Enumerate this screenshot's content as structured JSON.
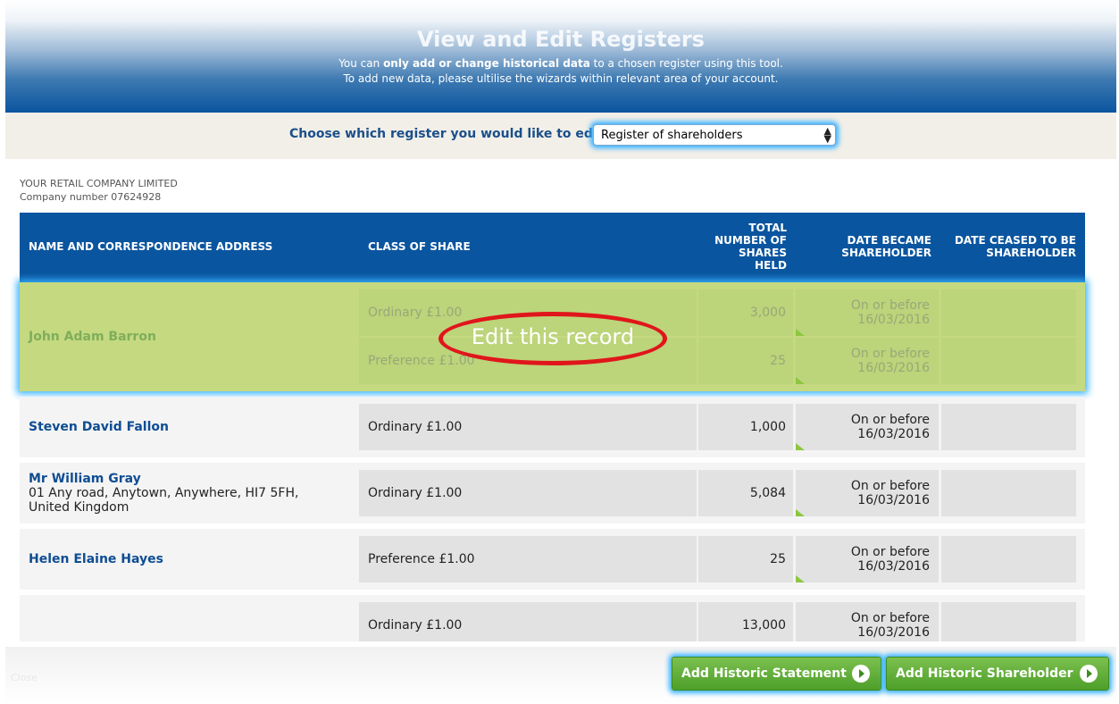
{
  "header": {
    "title": "View and Edit Registers",
    "line1_prefix": "You can ",
    "line1_bold": "only add or change historical data",
    "line1_suffix": " to a chosen register using this tool.",
    "line2": "To add new data, please ultilise the wizards within relevant area of your account."
  },
  "selector": {
    "label": "Choose which register you would like to edit",
    "value": "Register of shareholders"
  },
  "company": {
    "name": "YOUR RETAIL COMPANY LIMITED",
    "number": "Company number 07624928"
  },
  "table": {
    "headers": {
      "name": "NAME AND CORRESPONDENCE ADDRESS",
      "class": "CLASS OF SHARE",
      "total": [
        "TOTAL",
        "NUMBER OF",
        "SHARES",
        "HELD"
      ],
      "became": [
        "DATE BECAME",
        "SHAREHOLDER"
      ],
      "ceased": [
        "DATE CEASED TO BE",
        "SHAREHOLDER"
      ]
    },
    "rows": [
      {
        "name": "John Adam Barron",
        "address": "",
        "holdings": [
          {
            "class": "Ordinary £1.00",
            "total": "3,000",
            "became": [
              "On or before",
              "16/03/2016"
            ],
            "ceased": ""
          },
          {
            "class": "Preference £1.00",
            "total": "25",
            "became": [
              "On or before",
              "16/03/2016"
            ],
            "ceased": ""
          }
        ]
      },
      {
        "name": "Steven David Fallon",
        "address": "",
        "holdings": [
          {
            "class": "Ordinary £1.00",
            "total": "1,000",
            "became": [
              "On or before",
              "16/03/2016"
            ],
            "ceased": ""
          }
        ]
      },
      {
        "name": "Mr William Gray",
        "address": "01 Any road, Anytown, Anywhere, HI7 5FH, United Kingdom",
        "holdings": [
          {
            "class": "Ordinary £1.00",
            "total": "5,084",
            "became": [
              "On or before",
              "16/03/2016"
            ],
            "ceased": ""
          }
        ]
      },
      {
        "name": "Helen Elaine Hayes",
        "address": "",
        "holdings": [
          {
            "class": "Preference £1.00",
            "total": "25",
            "became": [
              "On or before",
              "16/03/2016"
            ],
            "ceased": ""
          }
        ]
      },
      {
        "name": "",
        "address": "",
        "holdings": [
          {
            "class": "Ordinary £1.00",
            "total": "13,000",
            "became": [
              "On or before",
              "16/03/2016"
            ],
            "ceased": ""
          }
        ]
      }
    ]
  },
  "overlay": {
    "edit_label": "Edit this record"
  },
  "footer": {
    "close_label": "Close"
  },
  "buttons": {
    "add_statement": "Add Historic Statement",
    "add_shareholder": "Add Historic Shareholder"
  },
  "colors": {
    "brand_blue": "#0a559f",
    "highlight_green": "#c4d980",
    "button_green": "#4e9f2b",
    "focus_glow": "#36b3ff",
    "annotation_red": "#e0161b"
  }
}
